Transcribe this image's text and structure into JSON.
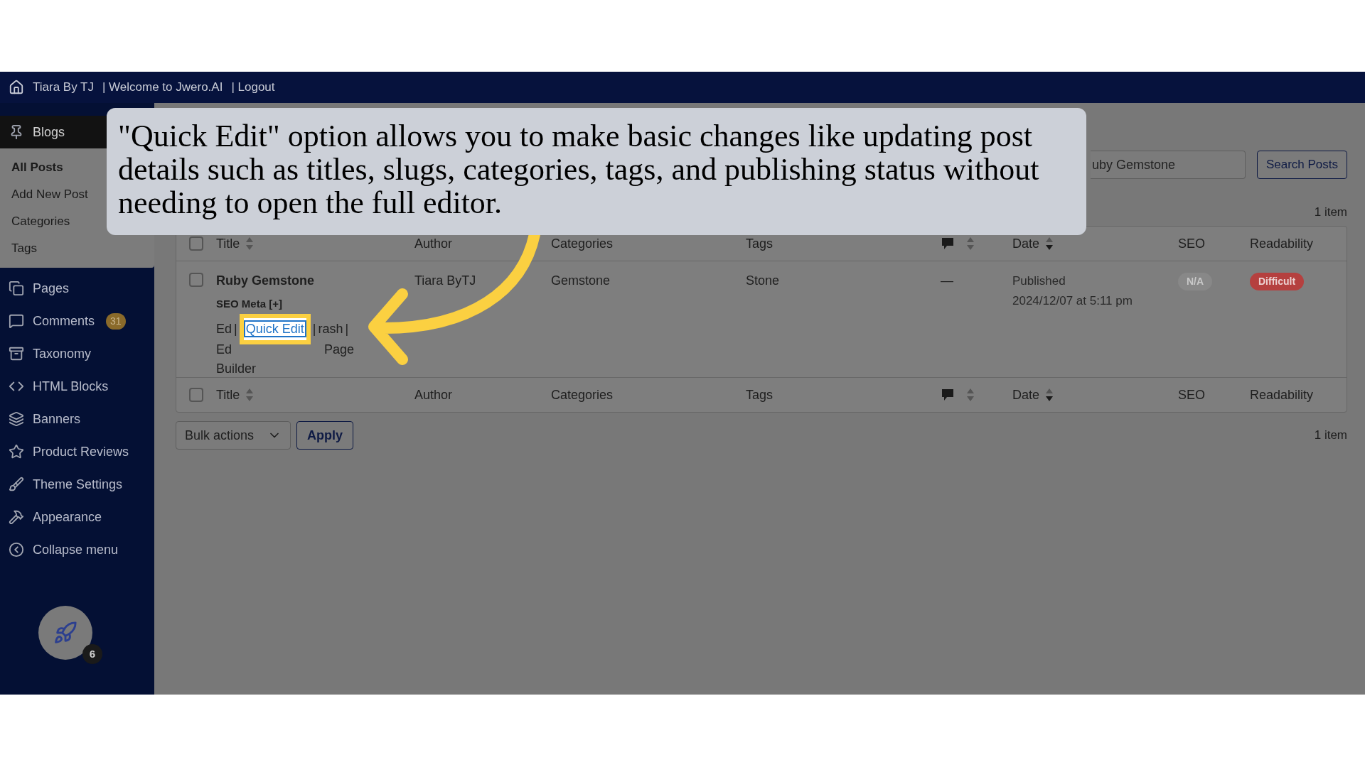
{
  "top_bar": {
    "items": [
      "Tiara By TJ",
      "| Welcome to Jwero.AI",
      "| Logout"
    ]
  },
  "sidebar": {
    "items": [
      {
        "label": "Blogs",
        "selected": true,
        "children": [
          {
            "label": "All Posts",
            "selected": true
          },
          {
            "label": "Add New Post",
            "selected": false
          },
          {
            "label": "Categories",
            "selected": false
          },
          {
            "label": "Tags",
            "selected": false
          }
        ]
      },
      {
        "label": "Pages",
        "selected": false
      },
      {
        "label": "Comments",
        "selected": false,
        "badge": "31"
      },
      {
        "label": "Taxonomy",
        "selected": false
      },
      {
        "label": "HTML Blocks",
        "selected": false
      },
      {
        "label": "Banners",
        "selected": false
      },
      {
        "label": "Product Reviews",
        "selected": false
      },
      {
        "label": "Theme Settings",
        "selected": false
      },
      {
        "label": "Appearance",
        "selected": false
      },
      {
        "label": "Collapse menu",
        "selected": false
      }
    ],
    "avatar_badge": "6"
  },
  "search": {
    "value": "uby Gemstone",
    "button": "Search Posts"
  },
  "count_top": "1 item",
  "table": {
    "header": {
      "checked": false,
      "columns": [
        {
          "label": "Title",
          "kind": "sortable"
        },
        {
          "label": "Author",
          "kind": "plain"
        },
        {
          "label": "Categories",
          "kind": "plain"
        },
        {
          "label": "Tags",
          "kind": "plain"
        },
        {
          "kind": "comments"
        },
        {
          "label": "Date",
          "kind": "sorted"
        },
        {
          "label": "SEO",
          "kind": "plain"
        },
        {
          "label": "Readability",
          "kind": "plain"
        }
      ]
    },
    "rows": [
      {
        "checked": false,
        "title": "Ruby Gemstone",
        "seo_meta": "SEO Meta [+]",
        "actions_line1": [
          "Ed",
          "|",
          "Quick Edit",
          "|",
          "rash",
          "|"
        ],
        "actions_line2": [
          "Ed",
          "Page"
        ],
        "actions_line3": "Builder",
        "author": "Tiara ByTJ",
        "categories": "Gemstone",
        "tags": "Stone",
        "comments": "—",
        "status": "Published",
        "date": "2024/12/07 at 5:11 pm",
        "seo": "N/A",
        "readability": "Difficult"
      }
    ],
    "footer": {
      "checked": false,
      "columns": [
        {
          "label": "Title",
          "kind": "sortable"
        },
        {
          "label": "Author",
          "kind": "plain"
        },
        {
          "label": "Categories",
          "kind": "plain"
        },
        {
          "label": "Tags",
          "kind": "plain"
        },
        {
          "kind": "comments"
        },
        {
          "label": "Date",
          "kind": "sorted"
        },
        {
          "label": "SEO",
          "kind": "plain"
        },
        {
          "label": "Readability",
          "kind": "plain"
        }
      ]
    }
  },
  "bulk": {
    "select": "Bulk actions",
    "apply": "Apply",
    "count": "1 item"
  },
  "callout": {
    "text": "\"Quick Edit\" option allows you to make basic changes like updating post details such as titles, slugs, categories, tags, and publishing status without needing to open the full editor."
  }
}
